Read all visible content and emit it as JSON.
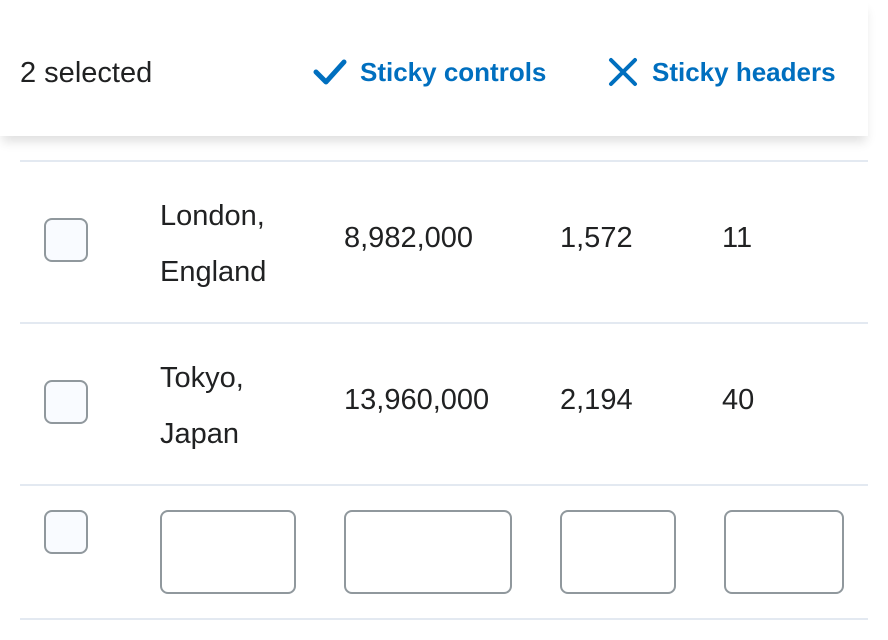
{
  "controls": {
    "selected_text": "2 selected",
    "sticky_controls": {
      "label": "Sticky controls",
      "icon": "check-icon",
      "state": true
    },
    "sticky_headers": {
      "label": "Sticky headers",
      "icon": "close-icon",
      "state": false
    },
    "accent_color": "#006fbf"
  },
  "rows": [
    {
      "city": "London, England",
      "population": "8,982,000",
      "area": "1,572",
      "elevation": "11",
      "checked": false
    },
    {
      "city": "Tokyo, Japan",
      "population": "13,960,000",
      "area": "2,194",
      "elevation": "40",
      "checked": false
    }
  ],
  "input_row": {
    "checked": false,
    "city": "",
    "population": "",
    "area": "",
    "elevation": ""
  }
}
